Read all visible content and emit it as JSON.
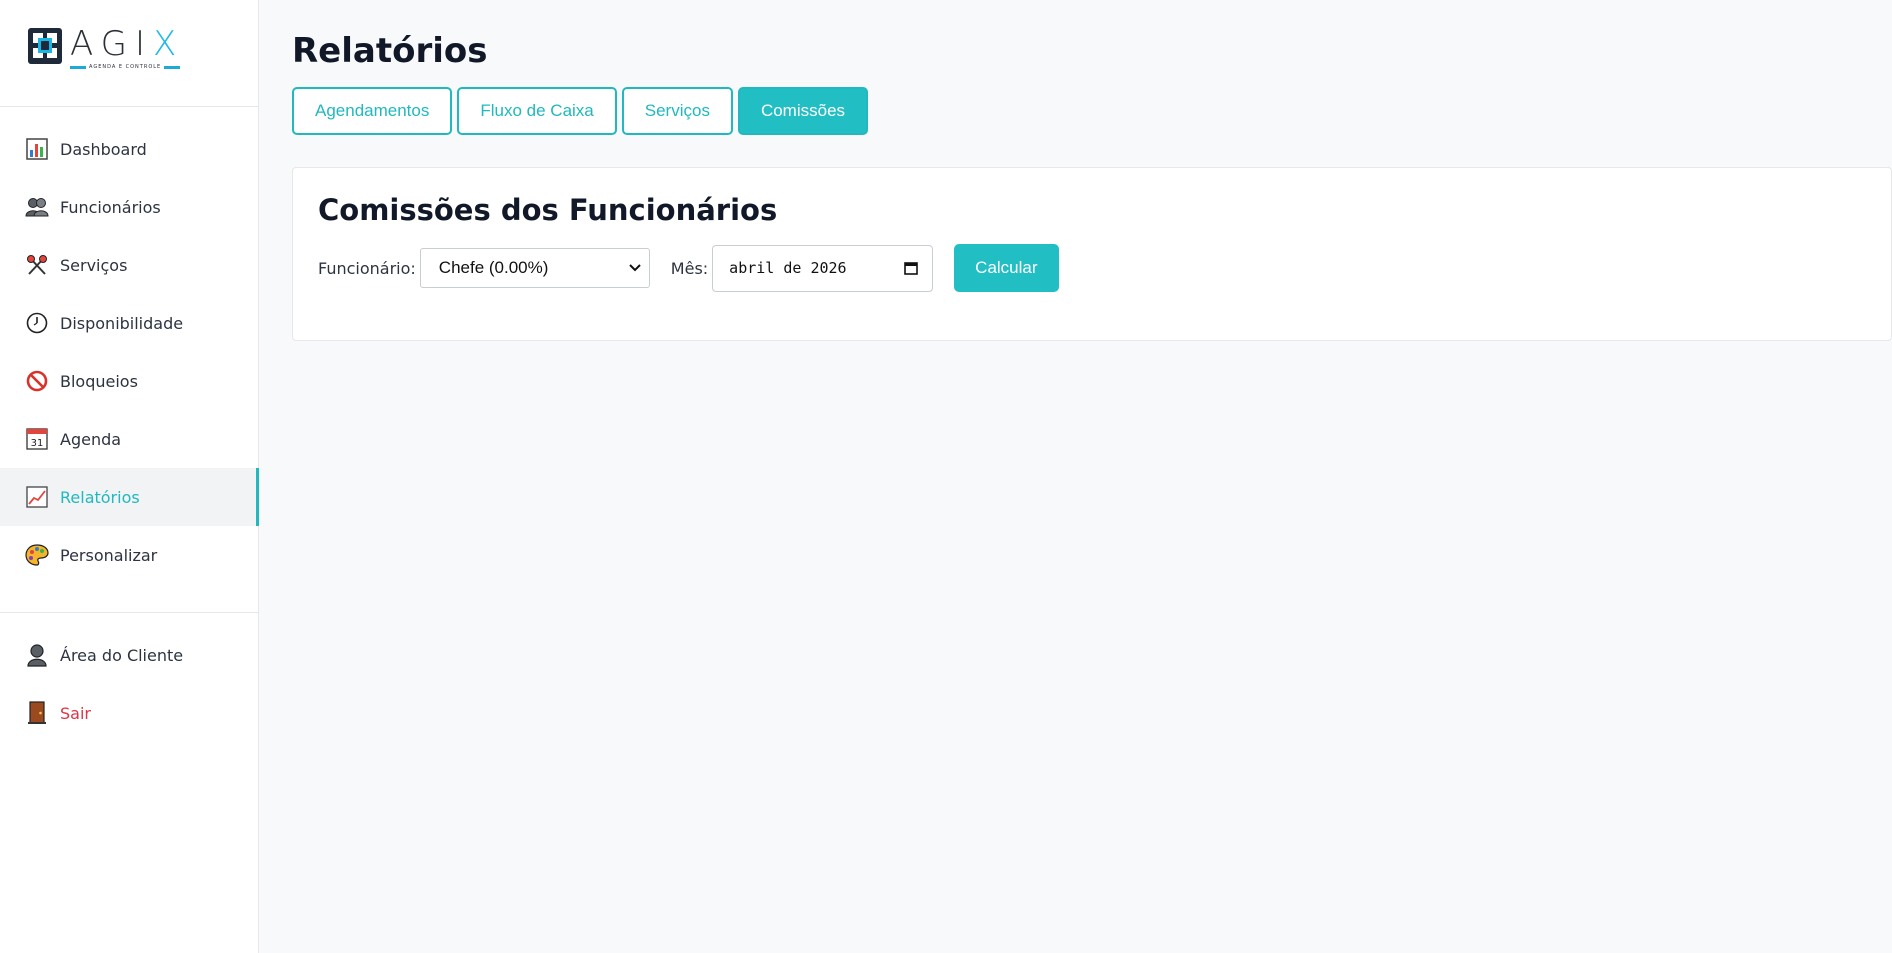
{
  "brand": {
    "name_prefix": "AGI",
    "name_suffix": "X",
    "tagline": "AGENDA E CONTROLE"
  },
  "sidebar": {
    "items": [
      {
        "label": "Dashboard",
        "icon": "bar-chart-icon"
      },
      {
        "label": "Funcionários",
        "icon": "users-icon"
      },
      {
        "label": "Serviços",
        "icon": "scissors-icon"
      },
      {
        "label": "Disponibilidade",
        "icon": "clock-icon"
      },
      {
        "label": "Bloqueios",
        "icon": "prohibited-icon"
      },
      {
        "label": "Agenda",
        "icon": "calendar-icon"
      },
      {
        "label": "Relatórios",
        "icon": "line-chart-icon",
        "active": true
      },
      {
        "label": "Personalizar",
        "icon": "palette-icon"
      }
    ],
    "footer_items": [
      {
        "label": "Área do Cliente",
        "icon": "person-icon"
      },
      {
        "label": "Sair",
        "icon": "door-icon"
      }
    ],
    "calendar_day": "31"
  },
  "main": {
    "title": "Relatórios",
    "tabs": [
      {
        "label": "Agendamentos"
      },
      {
        "label": "Fluxo de Caixa"
      },
      {
        "label": "Serviços"
      },
      {
        "label": "Comissões",
        "active": true
      }
    ]
  },
  "commissions": {
    "title": "Comissões dos Funcionários",
    "employee_label": "Funcionário:",
    "employee_value": "Chefe (0.00%)",
    "month_label": "Mês:",
    "month_value": "abril de 2026",
    "calculate_label": "Calcular"
  },
  "colors": {
    "accent": "#21bfc4",
    "logout": "#dc3545",
    "logo_x": "#1fb8e8"
  }
}
